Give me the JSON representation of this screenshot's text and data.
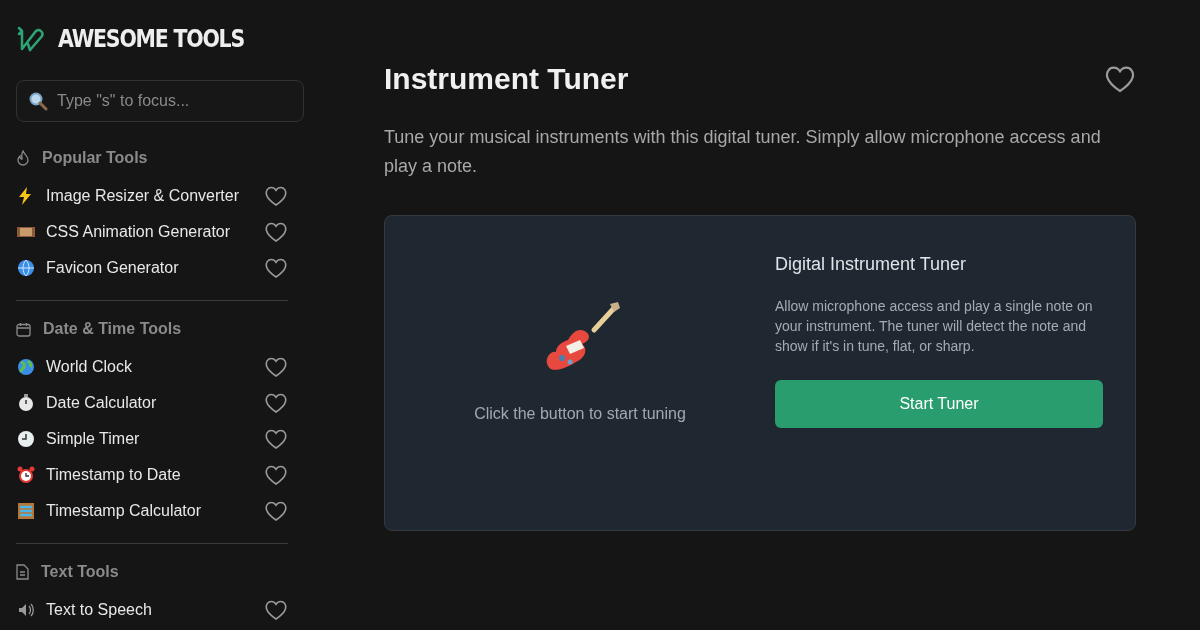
{
  "brand": {
    "name": "AWESOME TOOLS"
  },
  "search": {
    "placeholder": "Type \"s\" to focus..."
  },
  "sidebar": {
    "sections": [
      {
        "title": "Popular Tools",
        "items": [
          {
            "label": "Image Resizer & Converter",
            "favorite": false
          },
          {
            "label": "CSS Animation Generator",
            "favorite": false
          },
          {
            "label": "Favicon Generator",
            "favorite": false
          }
        ]
      },
      {
        "title": "Date & Time Tools",
        "items": [
          {
            "label": "World Clock",
            "favorite": false
          },
          {
            "label": "Date Calculator",
            "favorite": false
          },
          {
            "label": "Simple Timer",
            "favorite": false
          },
          {
            "label": "Timestamp to Date",
            "favorite": false
          },
          {
            "label": "Timestamp Calculator",
            "favorite": false
          }
        ]
      },
      {
        "title": "Text Tools",
        "items": [
          {
            "label": "Text to Speech",
            "favorite": false
          }
        ]
      }
    ]
  },
  "page": {
    "title": "Instrument Tuner",
    "favorite": false,
    "description": "Tune your musical instruments with this digital tuner. Simply allow microphone access and play a note.",
    "tuner": {
      "hint": "Click the button to start tuning",
      "heading": "Digital Instrument Tuner",
      "instructions": "Allow microphone access and play a single note on your instrument. The tuner will detect the note and show if it's in tune, flat, or sharp.",
      "button": "Start Tuner"
    }
  }
}
